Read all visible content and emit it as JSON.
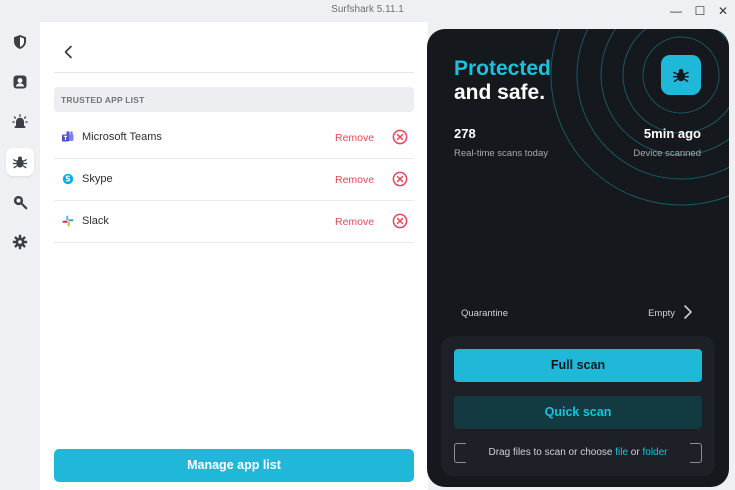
{
  "window": {
    "title": "Surfshark 5.11.1",
    "minimize_glyph": "—",
    "maximize_glyph": "☐",
    "close_glyph": "✕"
  },
  "sidebar": {
    "items": [
      {
        "icon": "shield-icon",
        "active": false
      },
      {
        "icon": "user-icon",
        "active": false
      },
      {
        "icon": "alert-icon",
        "active": false
      },
      {
        "icon": "antivirus-bug-icon",
        "active": true
      },
      {
        "icon": "search-icon",
        "active": false
      },
      {
        "icon": "gear-icon",
        "active": false
      }
    ]
  },
  "trusted_apps": {
    "header": "TRUSTED APP LIST",
    "apps": [
      {
        "name": "Microsoft Teams",
        "icon": "microsoft-teams-icon",
        "action": "Remove"
      },
      {
        "name": "Skype",
        "icon": "skype-icon",
        "action": "Remove"
      },
      {
        "name": "Slack",
        "icon": "slack-icon",
        "action": "Remove"
      }
    ],
    "manage_button": "Manage app list"
  },
  "status": {
    "headline_highlight": "Protected",
    "headline_rest": "and safe.",
    "scans_value": "278",
    "scans_label": "Real-time scans today",
    "last_scan_value": "5min ago",
    "last_scan_label": "Device scanned"
  },
  "quarantine": {
    "label": "Quarantine",
    "value": "Empty"
  },
  "scan": {
    "full_scan": "Full scan",
    "quick_scan": "Quick scan",
    "drop_text_prefix": "Drag files to scan or choose ",
    "drop_link_file": "file",
    "drop_text_or": " or ",
    "drop_link_folder": "folder"
  },
  "colors": {
    "accent": "#1fb8d8",
    "danger": "#e6465a",
    "dark_panel": "#15181d"
  }
}
